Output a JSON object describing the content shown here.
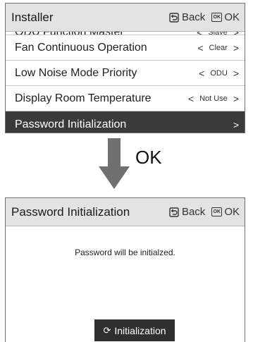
{
  "installer_screen": {
    "title": "Installer",
    "back_label": "Back",
    "ok_label": "OK",
    "ok_icon_text": "OK",
    "rows": [
      {
        "label": "ODU Function Master",
        "value": "Slave"
      },
      {
        "label": "Fan Continuous Operation",
        "value": "Clear"
      },
      {
        "label": "Low Noise Mode Priority",
        "value": "ODU"
      },
      {
        "label": "Display Room Temperature",
        "value": "Not Use"
      },
      {
        "label": "Password Initialization"
      }
    ]
  },
  "transition": {
    "label": "OK"
  },
  "password_screen": {
    "title": "Password Initialization",
    "back_label": "Back",
    "ok_label": "OK",
    "ok_icon_text": "OK",
    "message": "Password will be initialzed.",
    "button_label": "Initialization"
  },
  "icons": {
    "back": "back-arrow-icon",
    "ok": "ok-key-icon",
    "down_arrow": "down-arrow-icon",
    "refresh": "refresh-icon",
    "chevron_left": "chevron-left-icon",
    "chevron_right": "chevron-right-icon"
  }
}
